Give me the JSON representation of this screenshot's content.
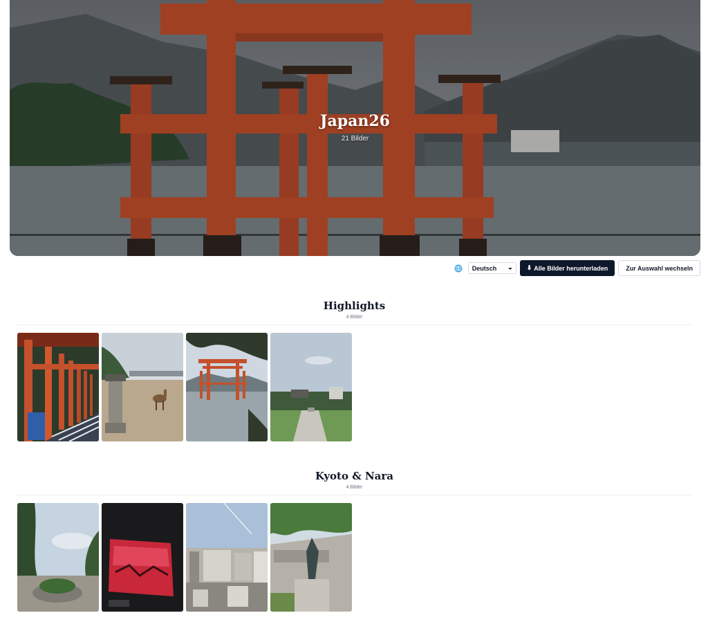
{
  "hero": {
    "title": "Japan26",
    "subtitle": "21 Bilder"
  },
  "toolbar": {
    "language": "Deutsch",
    "download_label": "Alle Bilder herunterladen",
    "download_icon": "download-icon",
    "switch_label": "Zur Auswahl wechseln"
  },
  "sections": [
    {
      "title": "Highlights",
      "count": "4 Bilder",
      "images": [
        "torii-corridor",
        "deer-beach-lantern",
        "floating-torii",
        "peace-park"
      ]
    },
    {
      "title": "Kyoto & Nara",
      "count": "4 Bilder",
      "images": [
        "garden-path",
        "red-painting",
        "city-view",
        "museum-statue"
      ]
    }
  ],
  "colors": {
    "accent_dark": "#0f172a",
    "torii_red": "#c4502c"
  }
}
